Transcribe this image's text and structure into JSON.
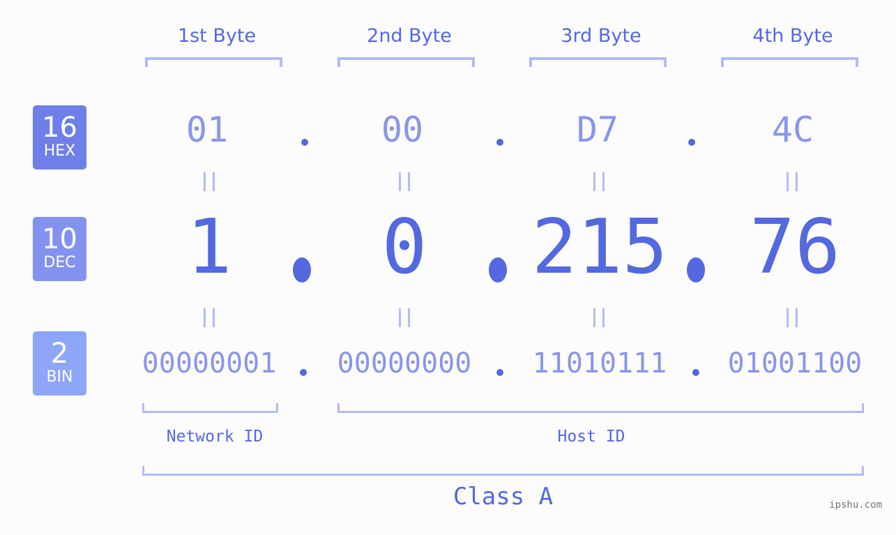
{
  "badges": [
    {
      "base": "16",
      "label": "HEX",
      "color": "#6f7fe9"
    },
    {
      "base": "10",
      "label": "DEC",
      "color": "#8492ef"
    },
    {
      "base": "2",
      "label": "BIN",
      "color": "#8da6f8"
    }
  ],
  "byte_headers": [
    "1st Byte",
    "2nd Byte",
    "3rd Byte",
    "4th Byte"
  ],
  "hex": [
    "01",
    "00",
    "D7",
    "4C"
  ],
  "dec": [
    "1",
    "0",
    "215",
    "76"
  ],
  "bin": [
    "00000001",
    "00000000",
    "11010111",
    "01001100"
  ],
  "separator": ".",
  "segments": {
    "network_label": "Network ID",
    "host_label": "Host ID"
  },
  "class_label": "Class A",
  "watermark": "ipshu.com",
  "colors": {
    "accent": "#5468e0",
    "light": "#8a95ea",
    "bracket": "#b2bbf5",
    "background": "#fbfcfb"
  }
}
